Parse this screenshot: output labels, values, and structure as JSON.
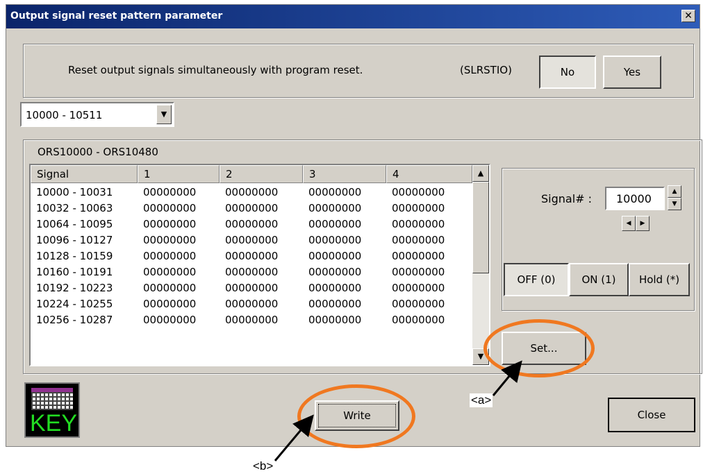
{
  "window": {
    "title": "Output signal reset pattern parameter",
    "close_glyph": "✕"
  },
  "reset_option": {
    "label": "Reset output signals simultaneously with program reset.",
    "code": "(SLRSTIO)",
    "no_label": "No",
    "yes_label": "Yes",
    "selected": "No"
  },
  "range_select": {
    "value": "10000 - 10511"
  },
  "group": {
    "label": "ORS10000 - ORS10480"
  },
  "table": {
    "headers": [
      "Signal",
      "1",
      "2",
      "3",
      "4"
    ],
    "rows": [
      [
        "10000 - 10031",
        "00000000",
        "00000000",
        "00000000",
        "00000000"
      ],
      [
        "10032 - 10063",
        "00000000",
        "00000000",
        "00000000",
        "00000000"
      ],
      [
        "10064 - 10095",
        "00000000",
        "00000000",
        "00000000",
        "00000000"
      ],
      [
        "10096 - 10127",
        "00000000",
        "00000000",
        "00000000",
        "00000000"
      ],
      [
        "10128 - 10159",
        "00000000",
        "00000000",
        "00000000",
        "00000000"
      ],
      [
        "10160 - 10191",
        "00000000",
        "00000000",
        "00000000",
        "00000000"
      ],
      [
        "10192 - 10223",
        "00000000",
        "00000000",
        "00000000",
        "00000000"
      ],
      [
        "10224 - 10255",
        "00000000",
        "00000000",
        "00000000",
        "00000000"
      ],
      [
        "10256 - 10287",
        "00000000",
        "00000000",
        "00000000",
        "00000000"
      ]
    ]
  },
  "signal_panel": {
    "signal_label": "Signal# :",
    "signal_value": "10000",
    "off_label": "OFF (0)",
    "on_label": "ON (1)",
    "hold_label": "Hold (*)",
    "selected_state": "OFF (0)"
  },
  "buttons": {
    "set": "Set...",
    "write": "Write",
    "close": "Close"
  },
  "keyboard_icon": {
    "label": "KEY"
  },
  "annotations": {
    "a": "<a>",
    "b": "<b>"
  },
  "colors": {
    "accent_annotation": "#f07820",
    "title_bar": "#0a246a",
    "key_text": "#22dd22"
  }
}
